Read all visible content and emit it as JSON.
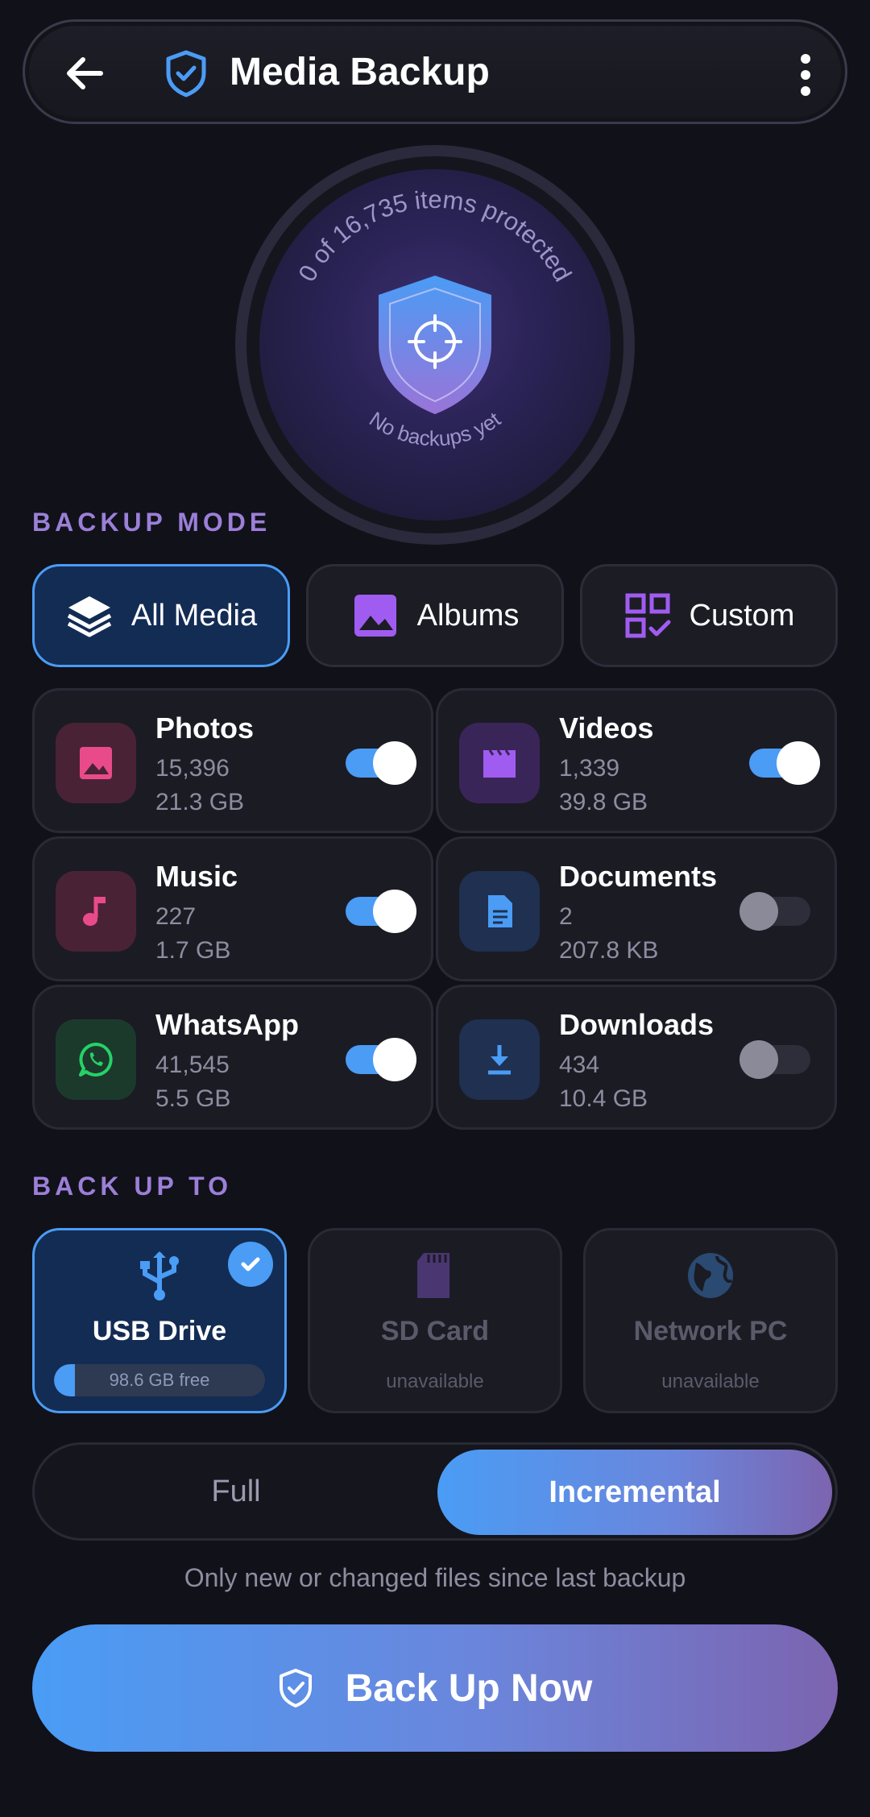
{
  "header": {
    "title": "Media Backup",
    "back_icon": "arrow-left-icon",
    "shield_icon": "shield-check-icon",
    "menu_icon": "more-vertical-icon"
  },
  "status": {
    "protected_text": "0 of 16,735 items protected",
    "last_backup": "No backups yet",
    "progress": 0
  },
  "backup_mode": {
    "label": "BACKUP MODE",
    "tabs": [
      {
        "label": "All Media",
        "icon": "layers-icon",
        "active": true
      },
      {
        "label": "Albums",
        "icon": "image-icon",
        "active": false
      },
      {
        "label": "Custom",
        "icon": "grid-check-icon",
        "active": false
      }
    ]
  },
  "categories": [
    {
      "name": "Photos",
      "count": "15,396",
      "size": "21.3 GB",
      "enabled": true,
      "icon": "image-icon",
      "color": "#e94b8a"
    },
    {
      "name": "Videos",
      "count": "1,339",
      "size": "39.8 GB",
      "enabled": true,
      "icon": "clapperboard-icon",
      "color": "#a05cf0"
    },
    {
      "name": "Music",
      "count": "227",
      "size": "1.7 GB",
      "enabled": true,
      "icon": "music-note-icon",
      "color": "#e94b8a"
    },
    {
      "name": "Documents",
      "count": "2",
      "size": "207.8 KB",
      "enabled": false,
      "icon": "document-icon",
      "color": "#4a9cf5"
    },
    {
      "name": "WhatsApp",
      "count": "41,545",
      "size": "5.5 GB",
      "enabled": true,
      "icon": "whatsapp-icon",
      "color": "#25d366"
    },
    {
      "name": "Downloads",
      "count": "434",
      "size": "10.4 GB",
      "enabled": false,
      "icon": "download-icon",
      "color": "#4a9cf5"
    }
  ],
  "destination": {
    "label": "BACK UP TO",
    "options": [
      {
        "name": "USB Drive",
        "detail": "98.6 GB free",
        "selected": true,
        "available": true,
        "icon": "usb-icon",
        "used_fraction": 0.1
      },
      {
        "name": "SD Card",
        "detail": "unavailable",
        "selected": false,
        "available": false,
        "icon": "sd-card-icon"
      },
      {
        "name": "Network PC",
        "detail": "unavailable",
        "selected": false,
        "available": false,
        "icon": "globe-icon"
      }
    ]
  },
  "backup_type": {
    "options": [
      "Full",
      "Incremental"
    ],
    "selected": "Incremental",
    "hint": "Only new or changed files since last backup"
  },
  "primary_action": {
    "label": "Back Up Now",
    "icon": "shield-check-icon"
  },
  "colors": {
    "accent": "#4a9cf5",
    "accent_purple": "#7c64b0",
    "section_label": "#9b7fd8",
    "background": "#111119"
  }
}
